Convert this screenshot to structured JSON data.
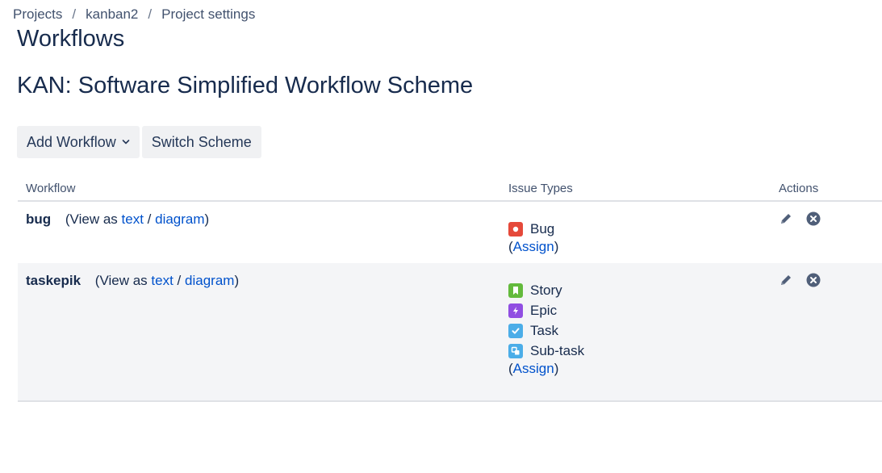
{
  "breadcrumb": {
    "items": [
      "Projects",
      "kanban2",
      "Project settings"
    ],
    "separator": "/"
  },
  "page_title": "Workflows",
  "scheme_title": "KAN: Software Simplified Workflow Scheme",
  "toolbar": {
    "add_workflow_label": "Add Workflow",
    "switch_scheme_label": "Switch Scheme"
  },
  "table": {
    "headers": {
      "workflow": "Workflow",
      "issue_types": "Issue Types",
      "actions": "Actions"
    },
    "rows": [
      {
        "name": "bug",
        "view_prefix": "(View as",
        "text_link": "text",
        "slash": "/",
        "diagram_link": "diagram",
        "close_paren": ")",
        "issue_types": [
          {
            "label": "Bug",
            "icon": "bug-icon",
            "color": "#e5493a"
          }
        ],
        "assign_open": "(",
        "assign_label": "Assign",
        "assign_close": ")"
      },
      {
        "name": "taskepik",
        "view_prefix": "(View as",
        "text_link": "text",
        "slash": "/",
        "diagram_link": "diagram",
        "close_paren": ")",
        "issue_types": [
          {
            "label": "Story",
            "icon": "story-icon",
            "color": "#63ba3c"
          },
          {
            "label": "Epic",
            "icon": "epic-icon",
            "color": "#904ee2"
          },
          {
            "label": "Task",
            "icon": "task-icon",
            "color": "#4bade8"
          },
          {
            "label": "Sub-task",
            "icon": "subtask-icon",
            "color": "#4bade8"
          }
        ],
        "assign_open": "(",
        "assign_label": "Assign",
        "assign_close": ")"
      }
    ]
  },
  "colors": {
    "link": "#0052cc",
    "text": "#172b4d",
    "button_bg": "#f0f1f3",
    "row_alt_bg": "#f4f5f7"
  }
}
